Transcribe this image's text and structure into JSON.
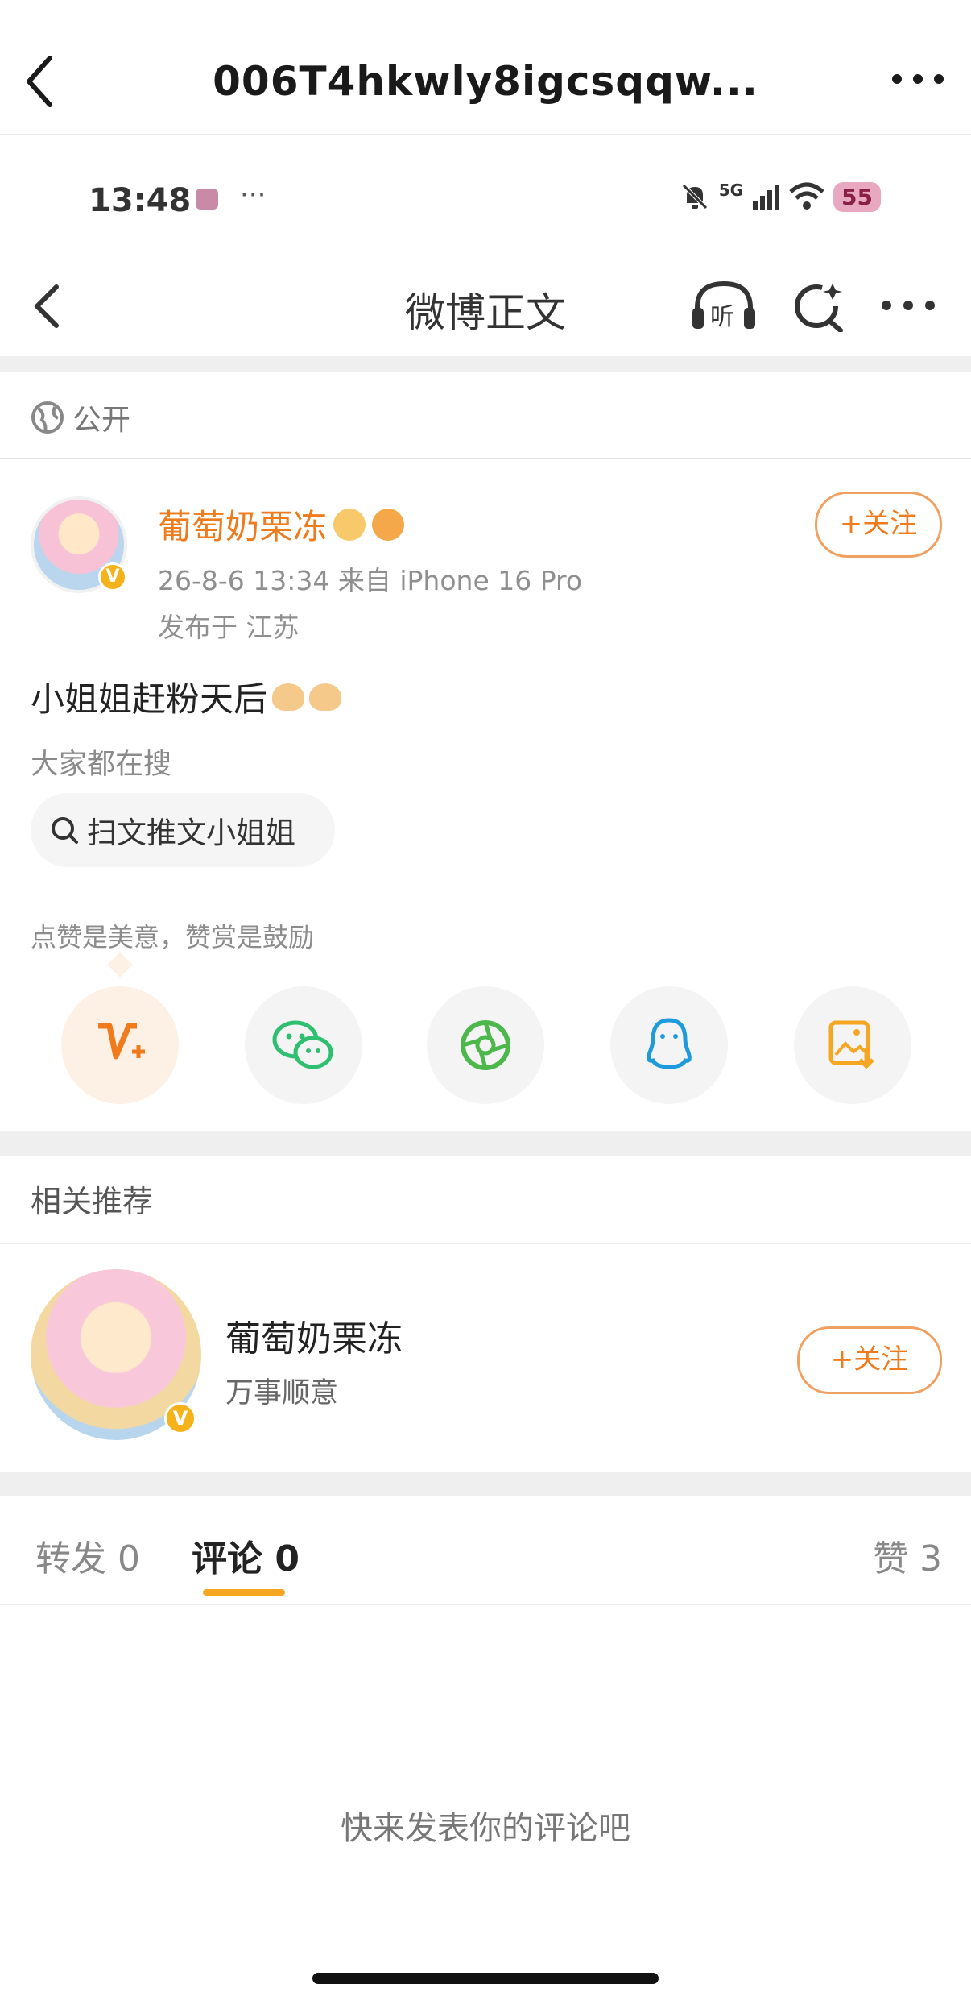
{
  "browser": {
    "title": "006T4hkwly8igcsqqw..."
  },
  "status_bar": {
    "time": "13:48",
    "dots": "···",
    "network": "5G",
    "battery": "55"
  },
  "app_header": {
    "title": "微博正文",
    "listen_label": "听"
  },
  "post": {
    "visibility": "公开",
    "author": "葡萄奶栗冻",
    "meta": "26-8-6 13:34  来自 iPhone 16 Pro",
    "location": "发布于 江苏",
    "text": "小姐姐赶粉天后",
    "follow_label": "+关注",
    "search_section_label": "大家都在搜",
    "search_query": "扫文推文小姐姐",
    "praise_hint": "点赞是美意，赞赏是鼓励",
    "verified_mark": "V"
  },
  "share_icons": [
    "reward-icon",
    "wechat-icon",
    "moments-icon",
    "qq-icon",
    "save-image-icon"
  ],
  "recommend": {
    "title": "相关推荐",
    "name": "葡萄奶栗冻",
    "desc": "万事顺意",
    "follow_label": "+关注"
  },
  "tabs": {
    "repost": "转发 0",
    "comment": "评论 0",
    "like": "赞 3"
  },
  "empty_comment": "快来发表你的评论吧",
  "colors": {
    "accent": "#f07b1d",
    "tab_underline": "#f5a623",
    "wechat": "#2fbf71",
    "qq": "#1e9bdc"
  }
}
